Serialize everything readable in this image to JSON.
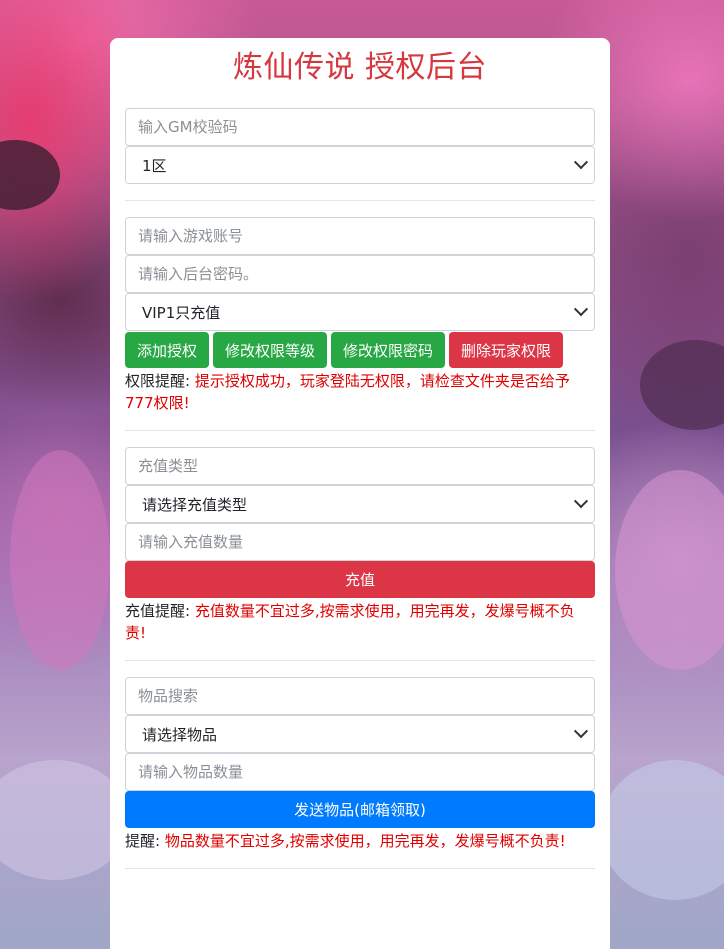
{
  "title": "炼仙传说 授权后台",
  "gm": {
    "code_placeholder": "输入GM校验码",
    "server_selected": "1区"
  },
  "auth": {
    "account_placeholder": "请输入游戏账号",
    "password_placeholder": "请输入后台密码。",
    "vip_selected": "VIP1只充值",
    "buttons": {
      "add": "添加授权",
      "modify_level": "修改权限等级",
      "modify_password": "修改权限密码",
      "delete": "删除玩家权限"
    },
    "notice_label": "权限提醒:",
    "notice_text": "提示授权成功，玩家登陆无权限，请检查文件夹是否给予777权限!"
  },
  "recharge": {
    "type_placeholder": "充值类型",
    "type_selected": "请选择充值类型",
    "amount_placeholder": "请输入充值数量",
    "button": "充值",
    "notice_label": "充值提醒:",
    "notice_text": "充值数量不宜过多,按需求使用，用完再发，发爆号概不负责!"
  },
  "items": {
    "search_placeholder": "物品搜索",
    "item_selected": "请选择物品",
    "amount_placeholder": "请输入物品数量",
    "button": "发送物品(邮箱领取)",
    "notice_label": "提醒:",
    "notice_text": "物品数量不宜过多,按需求使用，用完再发，发爆号概不负责!"
  },
  "colors": {
    "title": "#d5383f",
    "green": "#28a745",
    "red": "#dc3545",
    "blue": "#007bff",
    "warning_text": "#e00000"
  }
}
